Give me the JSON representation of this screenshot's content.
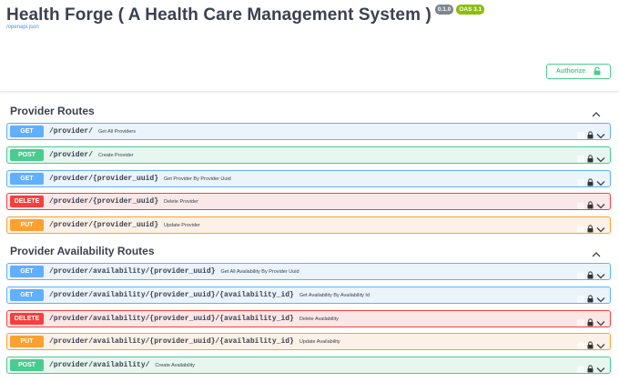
{
  "header": {
    "title": "Health Forge ( A Health Care Management System )",
    "version_badge": "0.1.0",
    "oas_badge": "OAS 3.1",
    "spec_link": "/openapi.json"
  },
  "auth": {
    "authorize_label": "Authorize"
  },
  "colors": {
    "get": "#61affe",
    "post": "#49cc90",
    "delete": "#f93e3e",
    "put": "#fca130"
  },
  "sections": [
    {
      "title": "Provider Routes",
      "operations": [
        {
          "method": "GET",
          "path": "/provider/",
          "summary": "Get All Providers"
        },
        {
          "method": "POST",
          "path": "/provider/",
          "summary": "Create Provider"
        },
        {
          "method": "GET",
          "path": "/provider/{provider_uuid}",
          "summary": "Get Provider By Provider Uuid"
        },
        {
          "method": "DELETE",
          "path": "/provider/{provider_uuid}",
          "summary": "Delete Provider"
        },
        {
          "method": "PUT",
          "path": "/provider/{provider_uuid}",
          "summary": "Update Provider"
        }
      ]
    },
    {
      "title": "Provider Availability Routes",
      "operations": [
        {
          "method": "GET",
          "path": "/provider/availability/{provider_uuid}",
          "summary": "Get All Availability By Provider Uuid"
        },
        {
          "method": "GET",
          "path": "/provider/availability/{provider_uuid}/{availability_id}",
          "summary": "Get Availability By Availability Id"
        },
        {
          "method": "DELETE",
          "path": "/provider/availability/{provider_uuid}/{availability_id}",
          "summary": "Delete Availability"
        },
        {
          "method": "PUT",
          "path": "/provider/availability/{provider_uuid}/{availability_id}",
          "summary": "Update Availability"
        },
        {
          "method": "POST",
          "path": "/provider/availability/",
          "summary": "Create Availability"
        }
      ]
    }
  ]
}
